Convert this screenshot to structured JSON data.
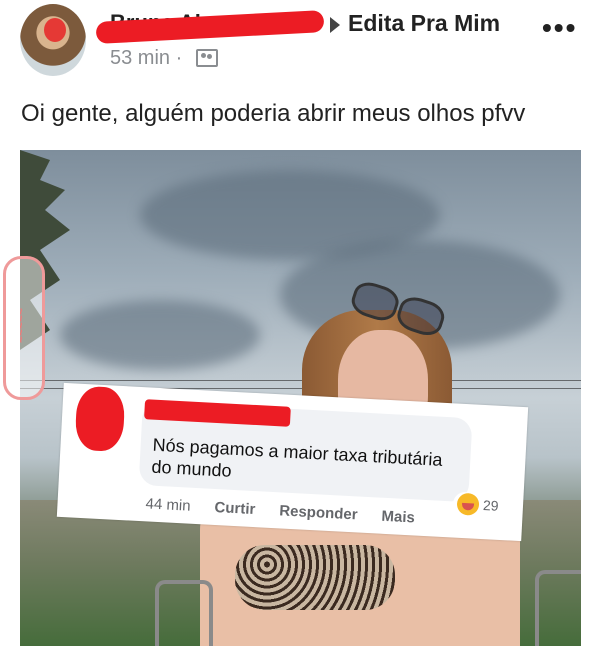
{
  "post": {
    "author_name": "Bruna Alessandra",
    "group_name": "Edita Pra Mim",
    "timestamp": "53 min",
    "separator": "·",
    "more_label": "•••",
    "text": "Oi gente, alguém poderia abrir meus olhos pfvv"
  },
  "icons": {
    "more": "more-options-icon",
    "audience": "group-audience-icon",
    "arrow": "group-arrow-icon",
    "reaction": "haha-reaction-icon"
  },
  "comment": {
    "text": "Nós pagamos a maior taxa tributária do mundo",
    "time": "44 min",
    "like_label": "Curtir",
    "reply_label": "Responder",
    "more_label": "Mais",
    "reaction_count": "29"
  },
  "colors": {
    "redaction": "#ec1c24",
    "bubble": "#f0f2f5",
    "meta_text": "#65676b",
    "watermark": "#ef9a9a"
  }
}
